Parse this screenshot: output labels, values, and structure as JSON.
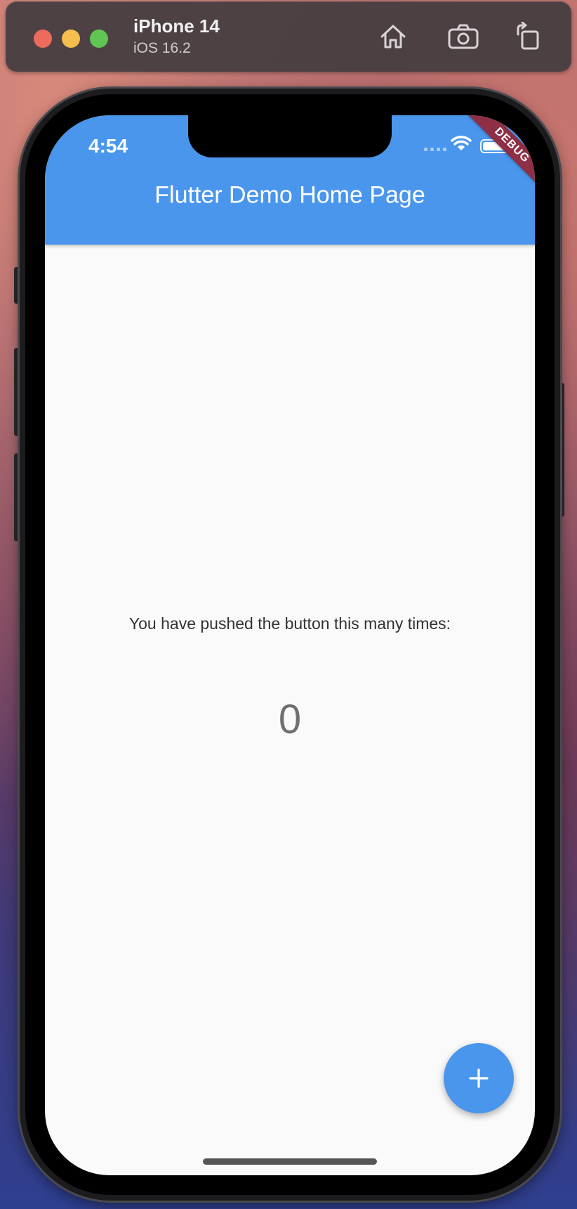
{
  "simulator": {
    "device_name": "iPhone 14",
    "os_version": "iOS 16.2",
    "buttons": {
      "home_icon": "home-icon",
      "screenshot_icon": "camera-icon",
      "rotate_icon": "rotate-icon"
    }
  },
  "status_bar": {
    "time": "4:54"
  },
  "app_bar": {
    "title": "Flutter Demo Home Page",
    "background_color": "#4a96ec"
  },
  "debug_banner": {
    "label": "DEBUG",
    "color": "#8f2f45"
  },
  "body": {
    "counter_label": "You have pushed the button this many times:",
    "counter_value": "0"
  },
  "fab": {
    "icon": "plus-icon",
    "color": "#4a96ec"
  }
}
